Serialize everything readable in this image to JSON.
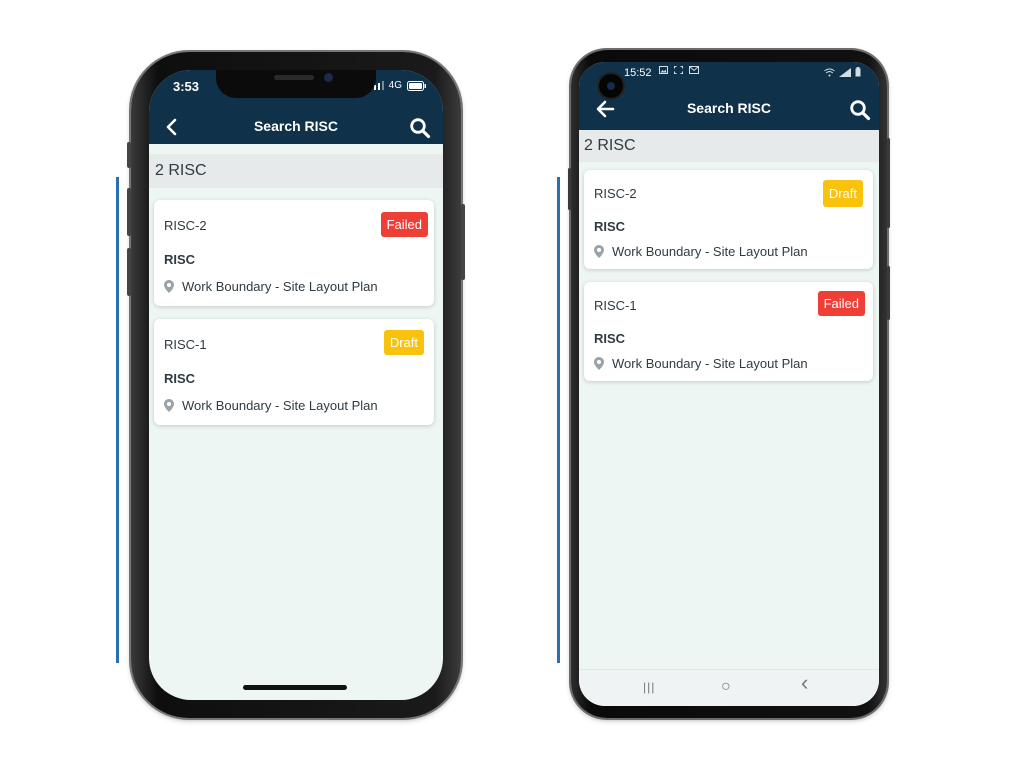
{
  "iphone": {
    "status": {
      "time": "3:53",
      "network": "4G"
    },
    "header": {
      "title": "Search RISC"
    },
    "count_label": "2 RISC",
    "cards": [
      {
        "id": "RISC-2",
        "status": "Failed",
        "status_color": "#ef3e36",
        "type": "RISC",
        "location": "Work Boundary - Site Layout Plan"
      },
      {
        "id": "RISC-1",
        "status": "Draft",
        "status_color": "#f9c20c",
        "type": "RISC",
        "location": "Work Boundary - Site Layout Plan"
      }
    ]
  },
  "android": {
    "status": {
      "time": "15:52"
    },
    "header": {
      "title": "Search RISC"
    },
    "count_label": "2 RISC",
    "cards": [
      {
        "id": "RISC-2",
        "status": "Draft",
        "status_color": "#f9c20c",
        "type": "RISC",
        "location": "Work Boundary - Site Layout Plan"
      },
      {
        "id": "RISC-1",
        "status": "Failed",
        "status_color": "#ef3e36",
        "type": "RISC",
        "location": "Work Boundary - Site Layout Plan"
      }
    ],
    "navbar": {
      "recents_glyph": "|||",
      "home_glyph": "○",
      "back_glyph": "‹"
    }
  },
  "colors": {
    "header_bg": "#0f3149",
    "screen_bg": "#eef6f4",
    "side_line": "#2a6fb5"
  }
}
